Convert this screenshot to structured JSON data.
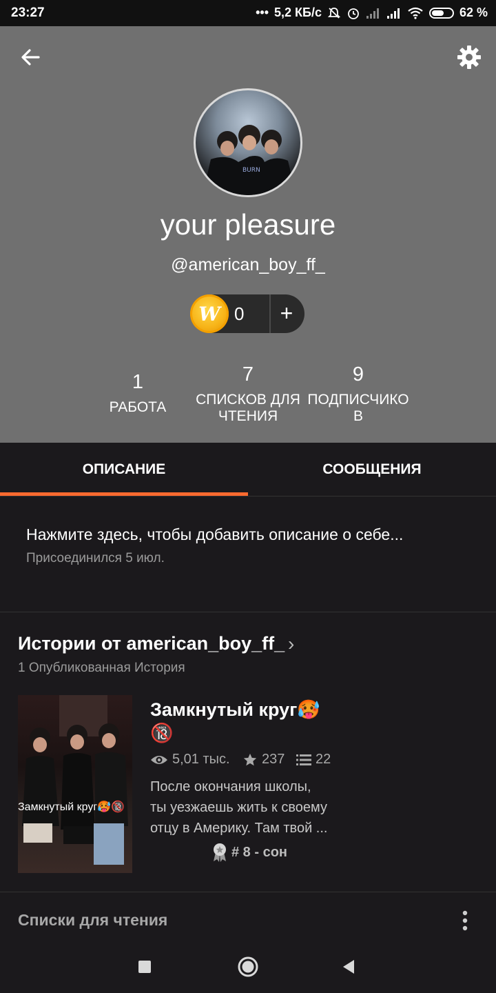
{
  "status_bar": {
    "time": "23:27",
    "network_speed": "5,2 КБ/с",
    "battery": "62 %",
    "battery_level": 0.62,
    "icons": [
      "dots-icon",
      "mute-icon",
      "alarm-icon",
      "signal-icon",
      "signal-icon",
      "wifi-icon",
      "battery-icon"
    ]
  },
  "header": {
    "back_icon": "arrow-left-icon",
    "settings_icon": "gear-icon",
    "display_name": "your pleasure",
    "username": "@american_boy_ff_",
    "coins": {
      "icon_letter": "W",
      "count": "0",
      "add_label": "+"
    },
    "stats": [
      {
        "value": "1",
        "label": "РАБОТА"
      },
      {
        "value": "7",
        "label_line1": "СПИСКОВ ДЛЯ",
        "label_line2": "ЧТЕНИЯ"
      },
      {
        "value": "9",
        "label_line1": "ПОДПИСЧИКО",
        "label_line2": "В"
      }
    ],
    "colors": {
      "background": "#707070",
      "accent": "#ff6a2f"
    }
  },
  "tabs": [
    {
      "label": "ОПИСАНИЕ",
      "active": true
    },
    {
      "label": "СООБЩЕНИЯ",
      "active": false
    }
  ],
  "description": {
    "prompt": "Нажмите здесь, чтобы добавить описание о себе...",
    "joined": "Присоединился 5 июл."
  },
  "stories": {
    "title": "Истории от american_boy_ff_",
    "count_label": "1 Опубликованная История",
    "items": [
      {
        "cover_text": "Замкнутый круг🥵🔞",
        "title_line1": "Замкнутый круг🥵",
        "title_line2": "🔞",
        "reads": "5,01 тыс.",
        "votes": "237",
        "parts": "22",
        "summary_lines": [
          "После окончания школы,",
          "ты уезжаешь жить к своему",
          "отцу в Америку. Там твой ..."
        ],
        "rank": "# 8 - сон"
      }
    ]
  },
  "reading_lists": {
    "title": "Списки для чтения",
    "more_icon": "more-vertical-icon"
  },
  "nav": {
    "icons": [
      "square-icon",
      "circle-icon",
      "triangle-back-icon"
    ]
  }
}
